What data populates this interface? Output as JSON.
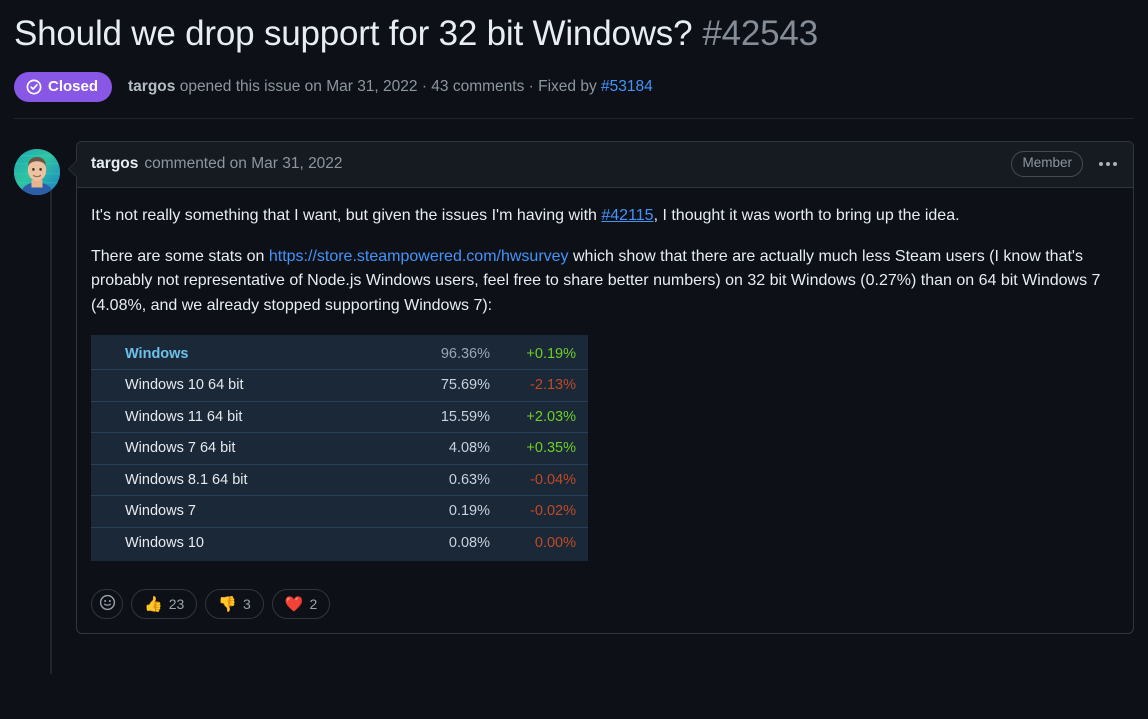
{
  "issue": {
    "title": "Should we drop support for 32 bit Windows?",
    "number": "#42543",
    "state_label": "Closed",
    "state_color": "#8957e5",
    "meta_author": "targos",
    "meta_opened": " opened this issue on Mar 31, 2022 · 43 comments · Fixed by ",
    "meta_fix_link": "#53184"
  },
  "comment": {
    "author": "targos",
    "meta": "commented on Mar 31, 2022",
    "member_badge": "Member",
    "kebab_name": "more-options-icon",
    "para1_a": "It's not really something that I want, but given the issues I'm having with ",
    "para1_link": "#42115",
    "para1_b": ", I thought it was worth to bring up the idea.",
    "para2_a": "There are some stats on ",
    "para2_link": "https://store.steampowered.com/hwsurvey",
    "para2_b": " which show that there are actually much less Steam users (I know that's probably not representative of Node.js Windows users, feel free to share better numbers) on 32 bit Windows (0.27%) than on 64 bit Windows 7 (4.08%, and we already stopped supporting Windows 7):"
  },
  "steam_table": {
    "rows": [
      {
        "name": "Windows",
        "pct": "96.36%",
        "delta": "+0.19%",
        "dir": "up"
      },
      {
        "name": "Windows 10 64 bit",
        "pct": "75.69%",
        "delta": "-2.13%",
        "dir": "down"
      },
      {
        "name": "Windows 11 64 bit",
        "pct": "15.59%",
        "delta": "+2.03%",
        "dir": "up"
      },
      {
        "name": "Windows 7 64 bit",
        "pct": "4.08%",
        "delta": "+0.35%",
        "dir": "up"
      },
      {
        "name": "Windows 8.1 64 bit",
        "pct": "0.63%",
        "delta": "-0.04%",
        "dir": "down"
      },
      {
        "name": "Windows 7",
        "pct": "0.19%",
        "delta": "-0.02%",
        "dir": "down"
      },
      {
        "name": "Windows 10",
        "pct": "0.08%",
        "delta": "0.00%",
        "dir": "flat"
      }
    ]
  },
  "reactions": {
    "add_label": "add-reaction",
    "items": [
      {
        "emoji": "👍",
        "count": "23",
        "name": "thumbs-up"
      },
      {
        "emoji": "👎",
        "count": "3",
        "name": "thumbs-down"
      },
      {
        "emoji": "❤️",
        "count": "2",
        "name": "heart"
      }
    ]
  }
}
